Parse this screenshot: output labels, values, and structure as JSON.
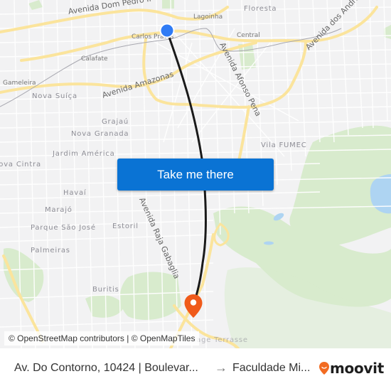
{
  "map": {
    "places": [
      {
        "name": "Floresta",
        "style": "district"
      },
      {
        "name": "Lagoinha",
        "style": "small"
      },
      {
        "name": "Carlos Prates",
        "style": "small"
      },
      {
        "name": "Central",
        "style": "small"
      },
      {
        "name": "Calafate",
        "style": "small"
      },
      {
        "name": "Gameleira",
        "style": "small"
      },
      {
        "name": "Nova Suíça",
        "style": "district"
      },
      {
        "name": "Grajaú",
        "style": "district"
      },
      {
        "name": "Nova Granada",
        "style": "district"
      },
      {
        "name": "Jardim América",
        "style": "district"
      },
      {
        "name": "Nova Cintra",
        "style": "district"
      },
      {
        "name": "Vila FUMEC",
        "style": "district"
      },
      {
        "name": "Havaí",
        "style": "district"
      },
      {
        "name": "Marajó",
        "style": "district"
      },
      {
        "name": "Parque São José",
        "style": "district"
      },
      {
        "name": "Estoril",
        "style": "district"
      },
      {
        "name": "Palmeiras",
        "style": "district"
      },
      {
        "name": "Buritis",
        "style": "district"
      },
      {
        "name": "Village Terrasse",
        "style": "district"
      }
    ],
    "roads": [
      {
        "name": "Avenida Dom Pedro II"
      },
      {
        "name": "Avenida Amazonas"
      },
      {
        "name": "Avenida Afonso Pena"
      },
      {
        "name": "Avenida dos Andradas"
      },
      {
        "name": "Avenida Raja Gabaglia"
      }
    ],
    "origin_marker": {
      "icon": "origin-dot-icon",
      "color": "#2f7bf5"
    },
    "destination_marker": {
      "icon": "map-pin-icon",
      "color": "#f05a1a"
    },
    "route_line_color": "#1a1a1a",
    "attribution": "© OpenStreetMap contributors | © OpenMapTiles"
  },
  "cta": {
    "label": "Take me there",
    "color": "#0a73d4"
  },
  "footer": {
    "from": "Av. Do Contorno, 10424 | Boulevar...",
    "arrow": "→",
    "to": "Faculdade Mi...",
    "brand": "moovit",
    "brand_color": "#f26b21"
  }
}
